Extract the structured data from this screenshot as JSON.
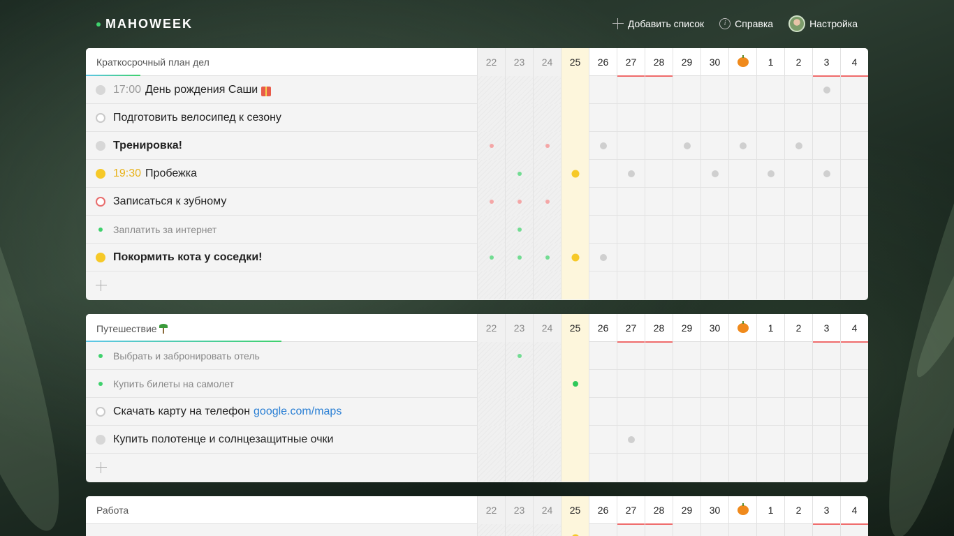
{
  "app": {
    "logo": "MAHOWEEK"
  },
  "nav": {
    "add_list": "Добавить список",
    "help": "Справка",
    "settings": "Настройка"
  },
  "colors": {
    "accent_green": "#3fd16d",
    "today": "#fdf6dc",
    "weekend_line": "#ef6b6b",
    "link": "#2a7fd4",
    "yellow": "#f6c928"
  },
  "days": [
    "22",
    "23",
    "24",
    "25",
    "26",
    "27",
    "28",
    "29",
    "30",
    "pumpkin",
    "1",
    "2",
    "3",
    "4"
  ],
  "lists": [
    {
      "title": "Краткосрочный план дел",
      "progress_pct": 7,
      "tasks": [
        {
          "bullet": "grey",
          "time": "17:00",
          "text": "День рождения Саши",
          "icon": "gift-icon",
          "style": "normal",
          "marks": {
            "12": "grey"
          }
        },
        {
          "bullet": "hollow-grey",
          "text": "Подготовить велосипед к сезону",
          "style": "normal",
          "marks": {}
        },
        {
          "bullet": "grey",
          "text": "Тренировка!",
          "style": "bold",
          "marks": {
            "0": "pink",
            "2": "pink",
            "4": "grey",
            "7": "grey",
            "9": "grey",
            "11": "grey"
          }
        },
        {
          "bullet": "yellow",
          "time": "19:30",
          "time_color": "yellow",
          "text": "Пробежка",
          "style": "normal",
          "marks": {
            "1": "green",
            "3": "yellow",
            "5": "grey",
            "8": "grey",
            "10": "grey",
            "12": "grey"
          }
        },
        {
          "bullet": "hollow-red",
          "text": "Записаться к зубному",
          "style": "normal",
          "marks": {
            "0": "pink",
            "1": "pink",
            "2": "pink"
          }
        },
        {
          "bullet": "green-sm",
          "text": "Заплатить за интернет",
          "style": "done",
          "marks": {
            "1": "green"
          }
        },
        {
          "bullet": "yellow",
          "text": "Покормить кота у соседки!",
          "style": "bold",
          "marks": {
            "0": "green",
            "1": "green",
            "2": "green",
            "3": "yellow",
            "4": "grey"
          }
        }
      ]
    },
    {
      "title": "Путешествие",
      "progress_pct": 25,
      "tasks": [
        {
          "bullet": "green-sm",
          "text": "Выбрать и забронировать отель",
          "style": "done",
          "marks": {
            "1": "green"
          }
        },
        {
          "bullet": "green-sm",
          "text": "Купить билеты на самолет",
          "style": "done",
          "marks": {
            "3": "green-big"
          }
        },
        {
          "bullet": "hollow-grey",
          "text": "Скачать карту на телефон",
          "link": "google.com/maps",
          "style": "normal",
          "marks": {}
        },
        {
          "bullet": "grey",
          "text": "Купить полотенце и солнцезащитные очки",
          "style": "normal",
          "marks": {
            "5": "grey"
          }
        }
      ]
    },
    {
      "title": "Работа",
      "progress_pct": 0,
      "tasks": []
    }
  ]
}
